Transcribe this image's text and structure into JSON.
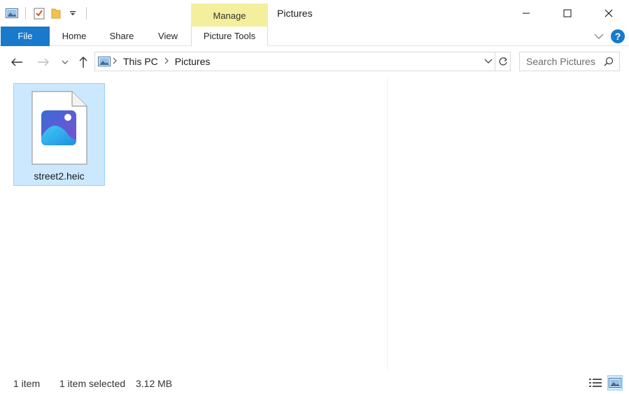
{
  "window": {
    "title": "Pictures",
    "context_tab": "Manage"
  },
  "ribbon": {
    "tabs": [
      "File",
      "Home",
      "Share",
      "View",
      "Picture Tools"
    ]
  },
  "address": {
    "crumbs": [
      "This PC",
      "Pictures"
    ]
  },
  "search": {
    "placeholder": "Search Pictures"
  },
  "files": [
    {
      "name": "street2.heic",
      "selected": true
    }
  ],
  "status": {
    "item_count": "1 item",
    "selection": "1 item selected",
    "size": "3.12 MB"
  },
  "colors": {
    "accent": "#1979ca",
    "manage_highlight": "#f4ef9c",
    "selection_fill": "#cce8ff",
    "selection_border": "#99d1ff"
  },
  "icons": {
    "qat": [
      "pictures-folder-icon",
      "properties-check-icon",
      "new-folder-icon",
      "customize-dropdown-icon"
    ],
    "nav": [
      "back-arrow-icon",
      "forward-arrow-icon",
      "recent-dropdown-icon",
      "up-arrow-icon"
    ]
  }
}
